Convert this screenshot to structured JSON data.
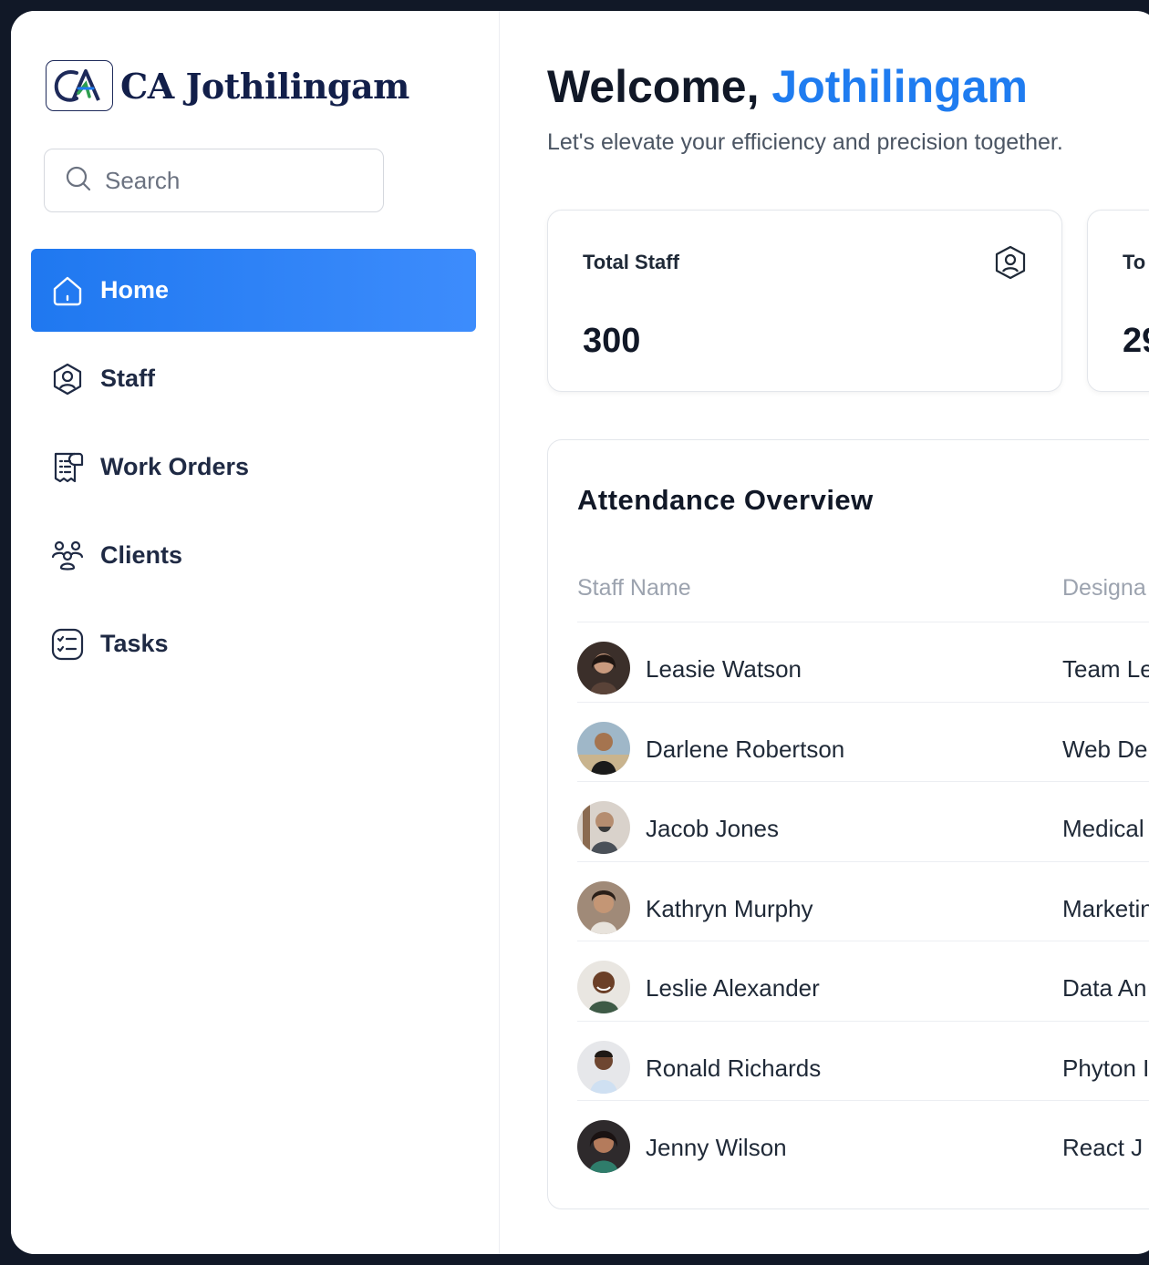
{
  "brand": {
    "name": "CA Jothilingam",
    "logo_text": "CA"
  },
  "search": {
    "placeholder": "Search"
  },
  "nav": [
    {
      "label": "Home",
      "icon": "home-icon",
      "active": true
    },
    {
      "label": "Staff",
      "icon": "user-shield-icon",
      "active": false
    },
    {
      "label": "Work Orders",
      "icon": "receipt-icon",
      "active": false
    },
    {
      "label": "Clients",
      "icon": "group-icon",
      "active": false
    },
    {
      "label": "Tasks",
      "icon": "checklist-icon",
      "active": false
    }
  ],
  "header": {
    "greeting": "Welcome,",
    "user": "Jothilingam",
    "subtitle": "Let's elevate your efficiency and precision together."
  },
  "stats": [
    {
      "title": "Total Staff",
      "value": "300",
      "icon": "user-shield-icon"
    },
    {
      "title": "To",
      "value": "29"
    }
  ],
  "attendance": {
    "title": "Attendance Overview",
    "columns": [
      "Staff Name",
      "Designa"
    ],
    "rows": [
      {
        "name": "Leasie Watson",
        "designation": "Team Le"
      },
      {
        "name": "Darlene Robertson",
        "designation": "Web De"
      },
      {
        "name": "Jacob Jones",
        "designation": "Medical"
      },
      {
        "name": "Kathryn Murphy",
        "designation": "Marketin"
      },
      {
        "name": "Leslie Alexander",
        "designation": "Data An"
      },
      {
        "name": "Ronald Richards",
        "designation": "Phyton I"
      },
      {
        "name": "Jenny Wilson",
        "designation": "React J"
      }
    ]
  },
  "colors": {
    "accent": "#1f7cf0",
    "nav_active": "#2a82f6",
    "text": "#111827",
    "muted": "#9ca3af"
  }
}
